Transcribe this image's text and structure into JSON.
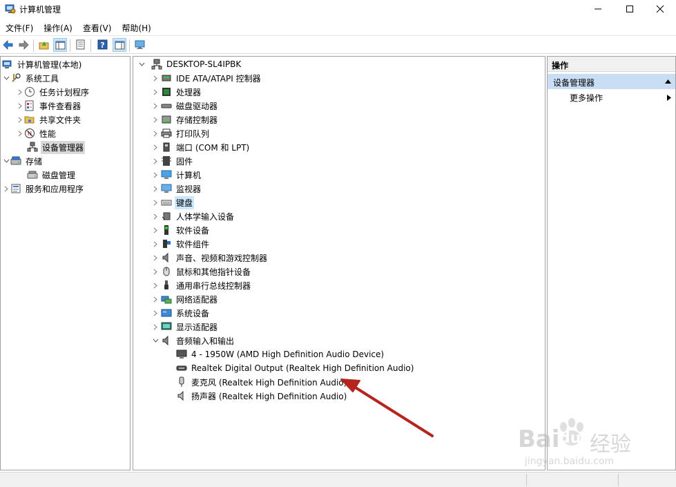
{
  "window": {
    "title": "计算机管理",
    "icon": "computer-management-icon"
  },
  "menu": [
    "文件(F)",
    "操作(A)",
    "查看(V)",
    "帮助(H)"
  ],
  "toolbar": {
    "buttons": [
      "back-icon",
      "forward-icon",
      "up-folder-icon",
      "show-hide-tree-icon",
      "properties-icon",
      "help-icon",
      "show-action-pane-icon",
      "monitor-icon"
    ]
  },
  "left_tree": {
    "root": "计算机管理(本地)",
    "system_tools": "系统工具",
    "task_scheduler": "任务计划程序",
    "event_viewer": "事件查看器",
    "shared_folders": "共享文件夹",
    "performance": "性能",
    "device_manager": "设备管理器",
    "storage": "存储",
    "disk_management": "磁盘管理",
    "services_apps": "服务和应用程序"
  },
  "device_tree": {
    "root": "DESKTOP-SL4IPBK",
    "categories": [
      "IDE ATA/ATAPI 控制器",
      "处理器",
      "磁盘驱动器",
      "存储控制器",
      "打印队列",
      "端口 (COM 和 LPT)",
      "固件",
      "计算机",
      "监视器",
      "键盘",
      "人体学输入设备",
      "软件设备",
      "软件组件",
      "声音、视频和游戏控制器",
      "鼠标和其他指针设备",
      "通用串行总线控制器",
      "网络适配器",
      "系统设备",
      "显示适配器",
      "音频输入和输出"
    ],
    "audio_children": [
      "4 - 1950W (AMD High Definition Audio Device)",
      "Realtek Digital Output (Realtek High Definition Audio)",
      "麦克风 (Realtek High Definition Audio)",
      "扬声器 (Realtek High Definition Audio)"
    ]
  },
  "actions": {
    "header": "操作",
    "section": "设备管理器",
    "more": "更多操作"
  },
  "watermark": {
    "brand": "Bai",
    "brand2": "du",
    "cn": "经验",
    "url": "jingyan.baidu.com"
  },
  "colors": {
    "accent_selection": "#cce8ff",
    "action_section": "#c9def5",
    "annotation_arrow": "#b5241d"
  }
}
